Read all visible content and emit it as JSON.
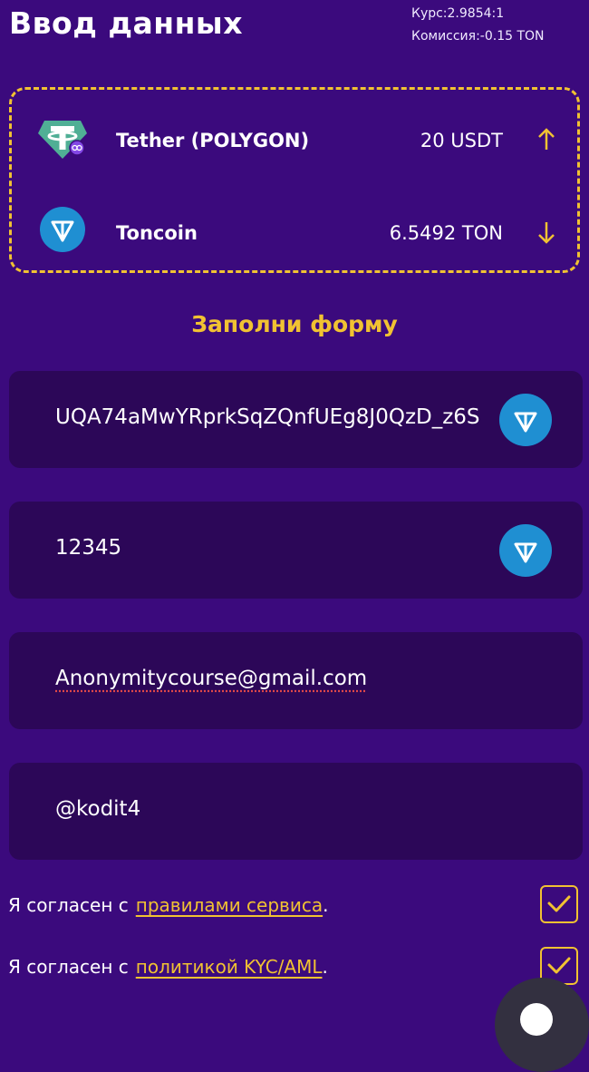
{
  "header": {
    "title": "Ввод данных",
    "rate_label": "Курс:2.9854:1",
    "commission_label": "Комиссия:-0.15 TON"
  },
  "pair": {
    "from": {
      "name": "Tether (POLYGON)",
      "amount": "20 USDT",
      "icon": "tether-polygon-icon",
      "direction": "arrow-up-icon"
    },
    "to": {
      "name": "Toncoin",
      "amount": "6.5492 TON",
      "icon": "toncoin-icon",
      "direction": "arrow-down-icon"
    }
  },
  "form": {
    "title": "Заполни форму",
    "wallet_value": "UQA74aMwYRprkSqZQnfUEg8J0QzD_z6S",
    "memo_value": "12345",
    "email_value": "Anonymitycourse@gmail.com",
    "telegram_value": "@kodit4"
  },
  "agreements": [
    {
      "prefix": "Я согласен с",
      "link": "правилами сервиса",
      "suffix": ".",
      "checked": true
    },
    {
      "prefix": "Я согласен с",
      "link": "политикой KYC/AML",
      "suffix": ".",
      "checked": true
    }
  ],
  "colors": {
    "background": "#3b0a7d",
    "field": "#2c0758",
    "accent": "#f1c232",
    "ton_blue": "#1f8fd2",
    "tether_green": "#50af95"
  }
}
